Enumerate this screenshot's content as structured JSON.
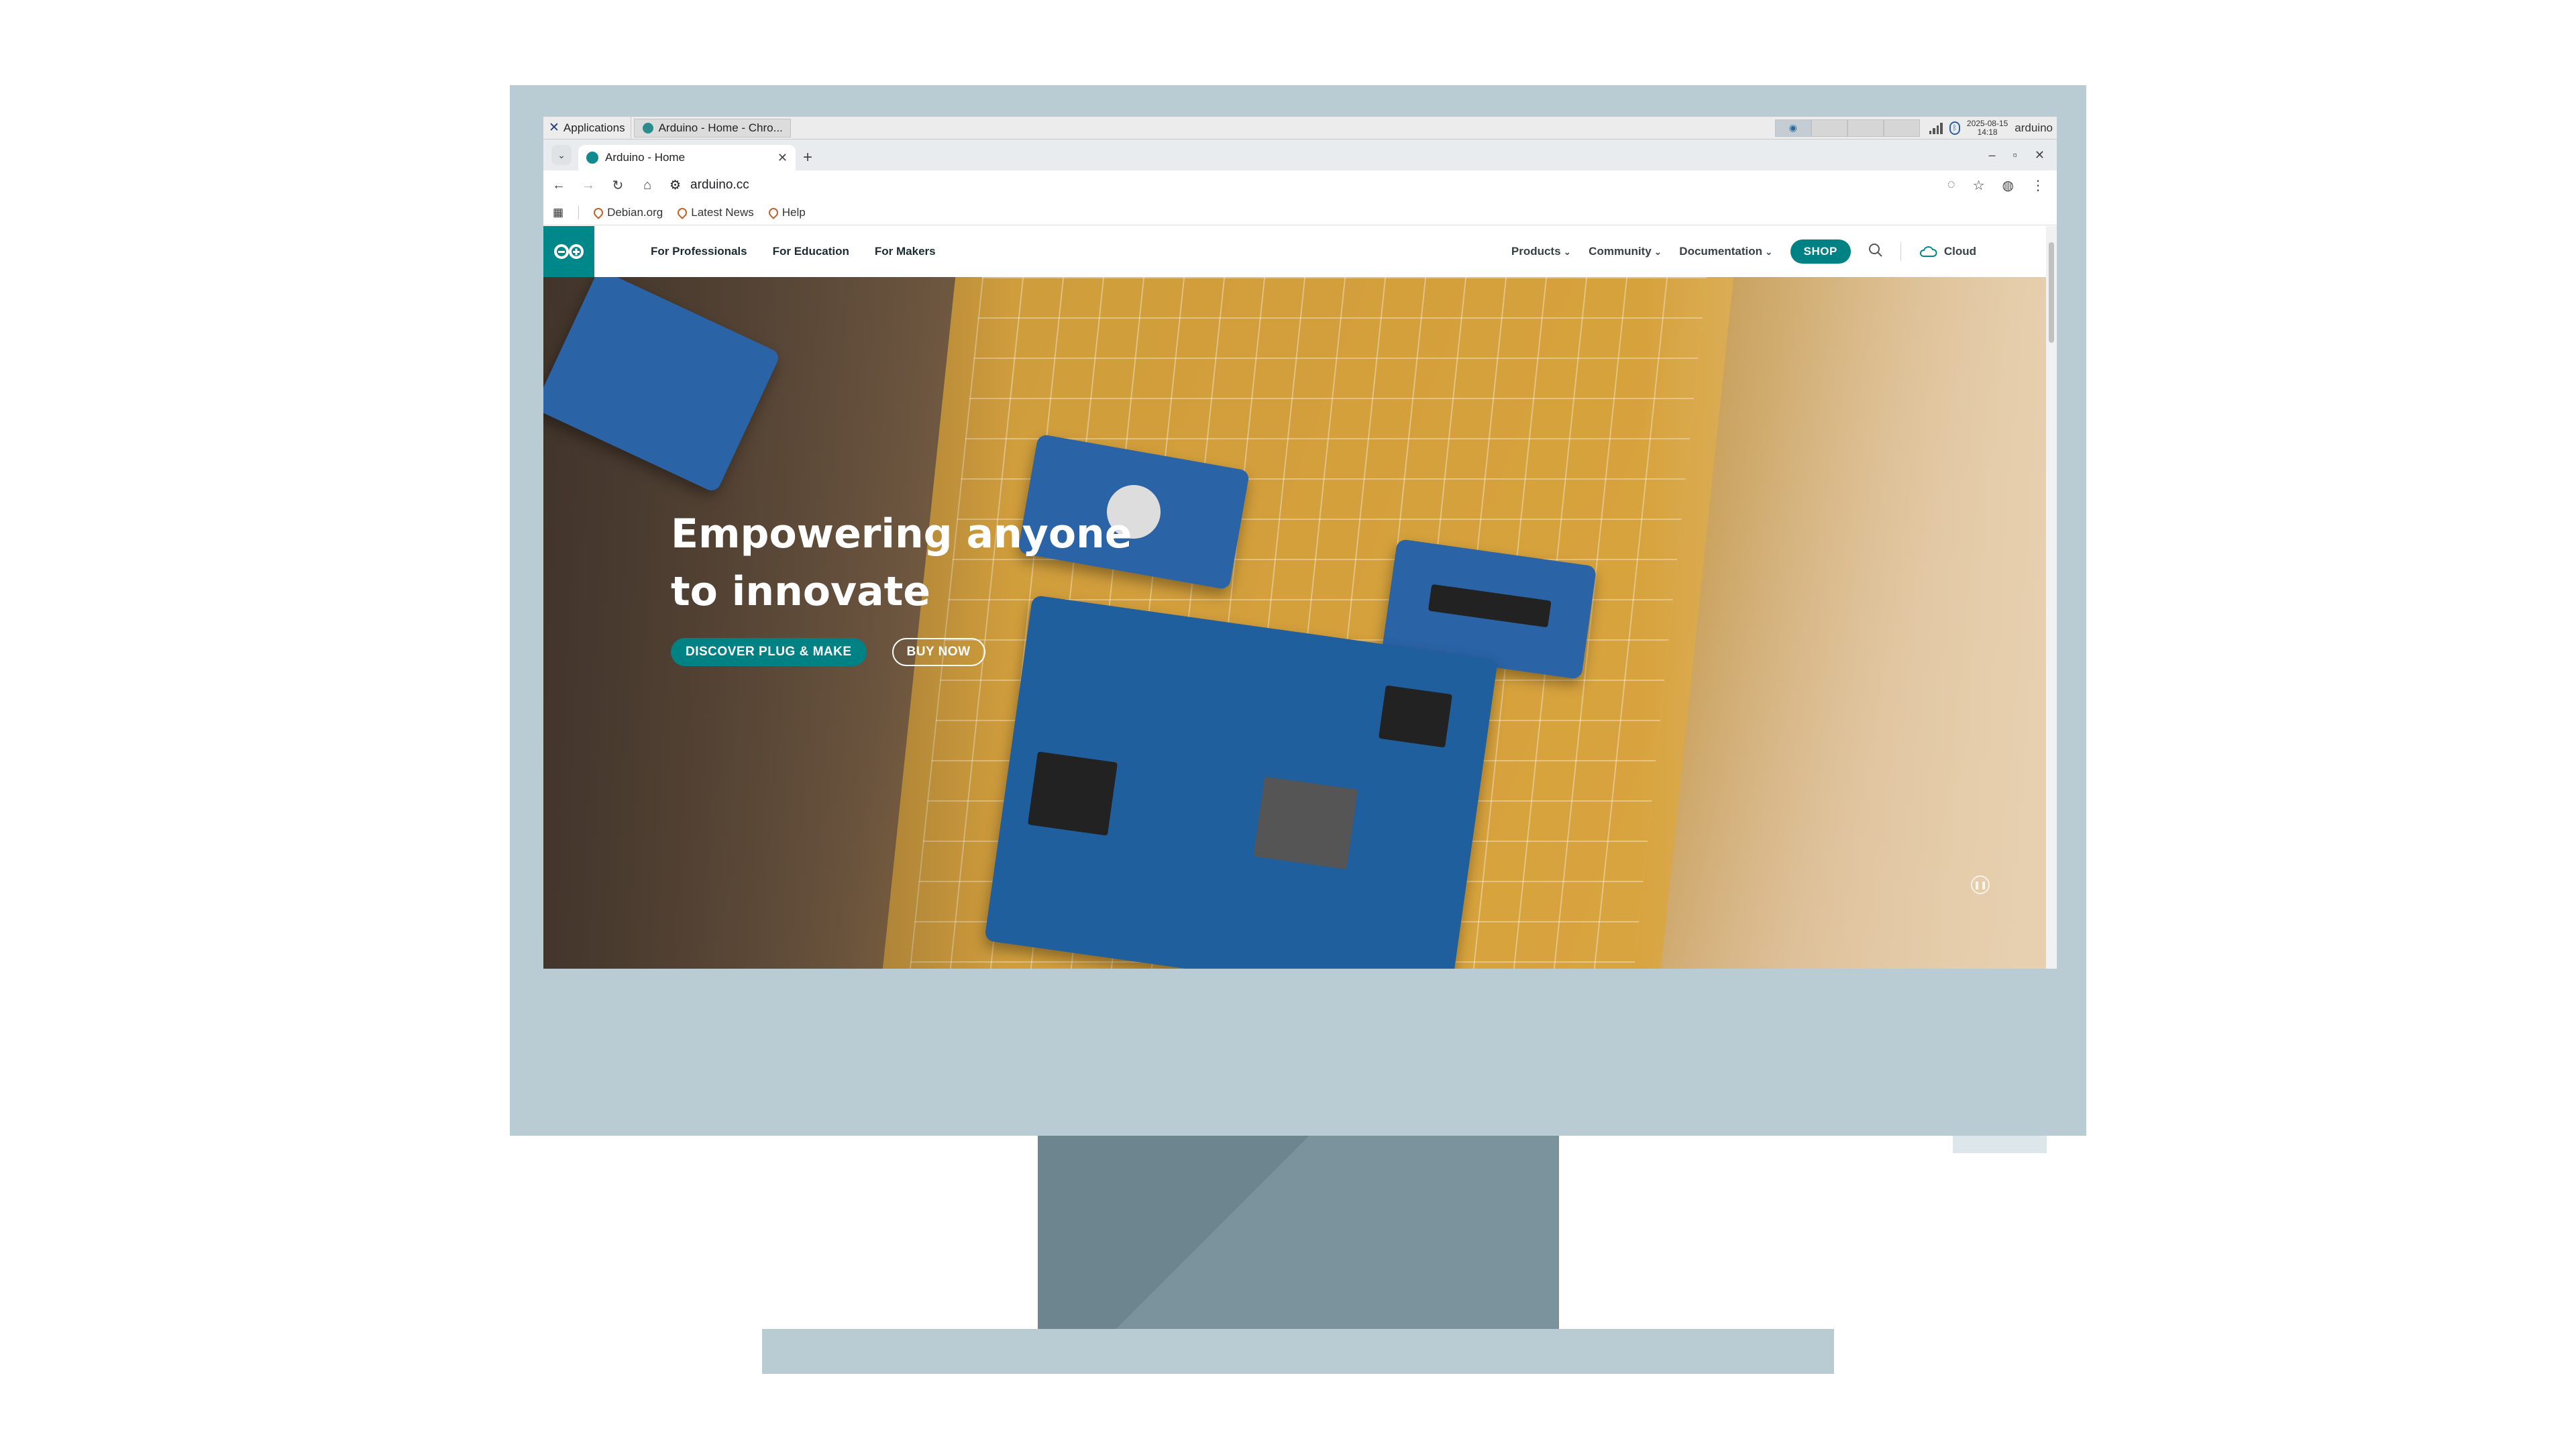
{
  "os_panel": {
    "applications_label": "Applications",
    "task_label": "Arduino - Home - Chro...",
    "clock_date": "2025-08-15",
    "clock_time": "14:18",
    "user": "arduino"
  },
  "browser": {
    "tab_title": "Arduino - Home",
    "url": "arduino.cc",
    "bookmarks": [
      {
        "label": "Debian.org"
      },
      {
        "label": "Latest News"
      },
      {
        "label": "Help"
      }
    ]
  },
  "site": {
    "nav_left": [
      "For Professionals",
      "For Education",
      "For Makers"
    ],
    "nav_right": {
      "products": "Products",
      "community": "Community",
      "documentation": "Documentation",
      "shop": "SHOP",
      "cloud": "Cloud"
    },
    "hero": {
      "title": "Empowering anyone to innovate",
      "primary_button": "DISCOVER PLUG & MAKE",
      "secondary_button": "BUY NOW"
    }
  },
  "colors": {
    "brand_teal": "#008184",
    "monitor_frame": "#b9cbd3",
    "monitor_stand": "#6d858e"
  },
  "icons": [
    "arduino-logo-icon",
    "search-icon",
    "cloud-icon",
    "pause-icon",
    "back-icon",
    "forward-icon",
    "reload-icon",
    "home-icon",
    "star-icon",
    "profile-icon",
    "menu-icon"
  ]
}
